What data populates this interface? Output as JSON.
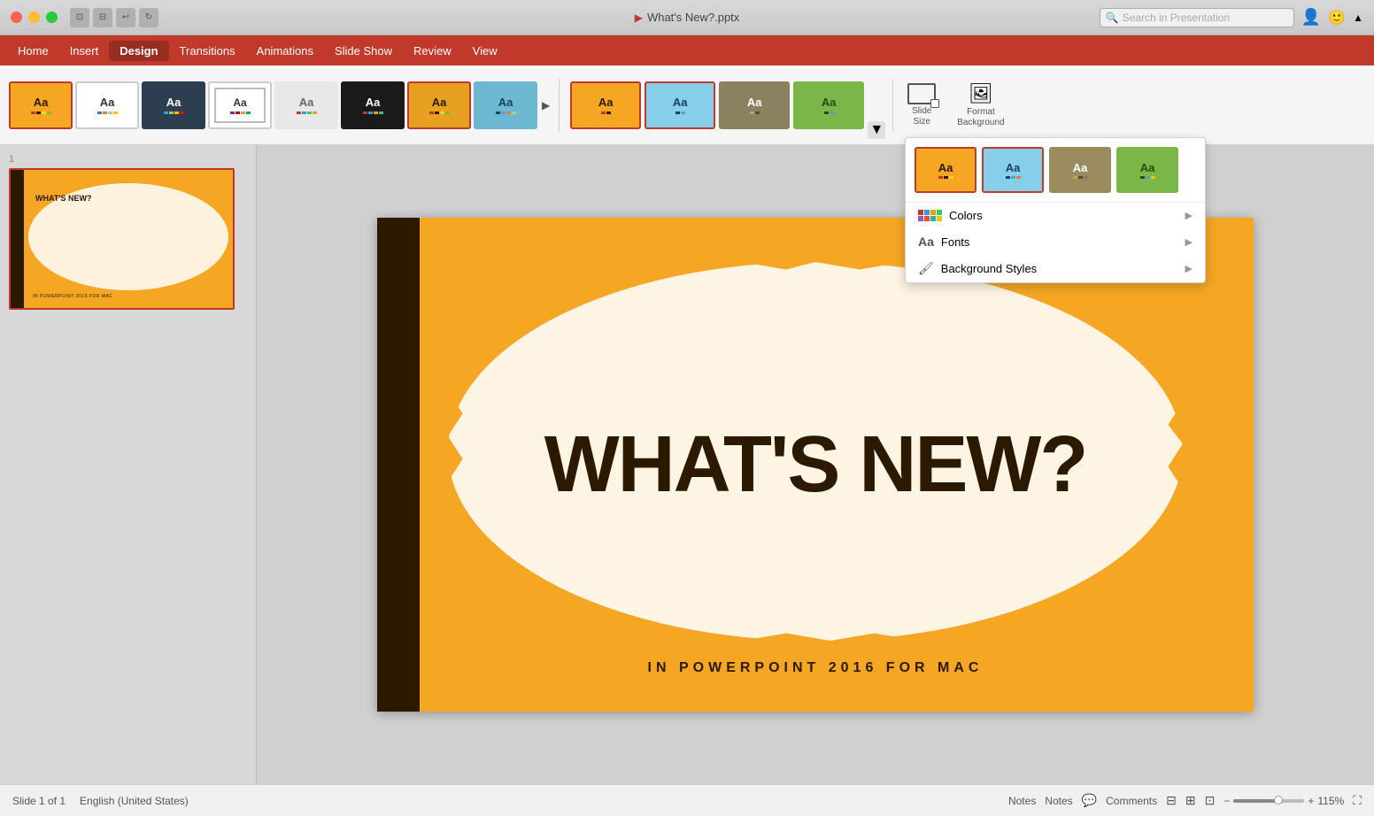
{
  "titlebar": {
    "filename": "What's New?.pptx",
    "search_placeholder": "Search in Presentation"
  },
  "menubar": {
    "items": [
      "Home",
      "Insert",
      "Design",
      "Transitions",
      "Animations",
      "Slide Show",
      "Review",
      "View"
    ],
    "active": "Design"
  },
  "ribbon": {
    "themes": [
      {
        "id": "t1",
        "label": "Aa",
        "selected": true
      },
      {
        "id": "t2",
        "label": "Aa",
        "selected": false
      },
      {
        "id": "t3",
        "label": "Aa",
        "selected": false
      },
      {
        "id": "t4",
        "label": "Aa",
        "selected": false
      },
      {
        "id": "t5",
        "label": "Aa",
        "selected": false
      },
      {
        "id": "t6",
        "label": "Aa",
        "selected": false
      },
      {
        "id": "t7",
        "label": "Aa",
        "selected": false
      },
      {
        "id": "t8",
        "label": "Aa",
        "selected": false
      }
    ],
    "extra_themes": [
      {
        "id": "et1",
        "label": "Aa"
      },
      {
        "id": "et2",
        "label": "Aa"
      },
      {
        "id": "et3",
        "label": "Aa"
      },
      {
        "id": "et4",
        "label": "Aa"
      }
    ],
    "slide_size_label": "Slide\nSize",
    "format_bg_label": "Format\nBackground"
  },
  "popup": {
    "themes": [
      {
        "id": "pt1",
        "selected": true
      },
      {
        "id": "pt2",
        "selected": false
      },
      {
        "id": "pt3",
        "selected": false
      },
      {
        "id": "pt4",
        "selected": false
      }
    ],
    "menu_items": [
      {
        "icon": "🎨",
        "label": "Colors",
        "has_arrow": true
      },
      {
        "icon": "Aa",
        "label": "Fonts",
        "has_arrow": true
      },
      {
        "icon": "🖼",
        "label": "Background Styles",
        "has_arrow": true
      }
    ]
  },
  "slide": {
    "number": "1",
    "title": "WHAT'S NEW?",
    "subtitle": "IN POWERPOINT 2016 FOR MAC"
  },
  "statusbar": {
    "slide_info": "Slide 1 of 1",
    "language": "English (United States)",
    "notes_label": "Notes",
    "comments_label": "Comments",
    "zoom_level": "115%"
  }
}
